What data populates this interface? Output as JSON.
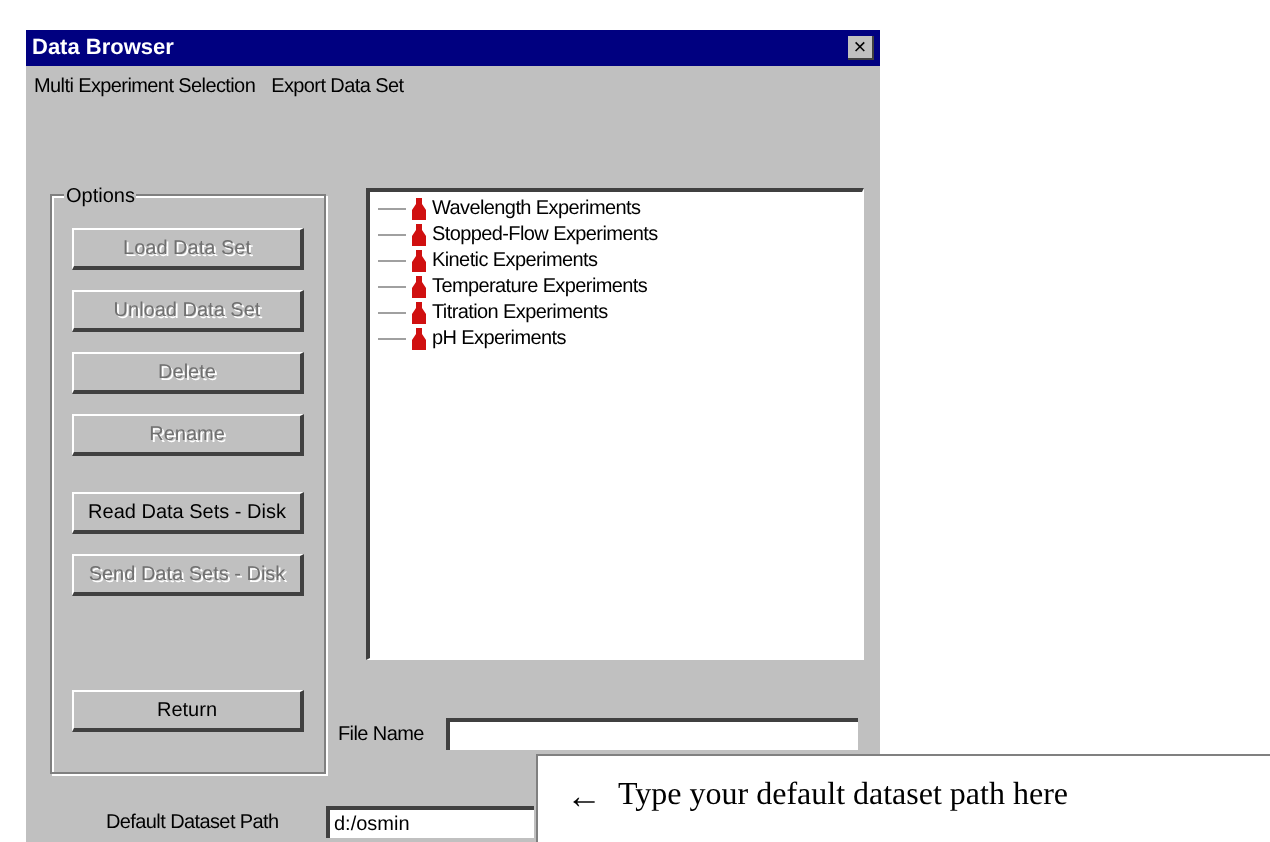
{
  "window": {
    "title": "Data Browser",
    "close": "×"
  },
  "menu": [
    "Multi Experiment Selection",
    "Export Data Set"
  ],
  "options": {
    "label": "Options",
    "buttons": [
      {
        "label": "Load Data Set",
        "disabled": true
      },
      {
        "label": "Unload Data Set",
        "disabled": true
      },
      {
        "label": "Delete",
        "disabled": true
      },
      {
        "label": "Rename",
        "disabled": true
      },
      {
        "label": "Read Data Sets - Disk",
        "disabled": false
      },
      {
        "label": "Send Data Sets - Disk",
        "disabled": true
      }
    ],
    "return_button": {
      "label": "Return",
      "disabled": false
    }
  },
  "tree": {
    "items": [
      "Wavelength Experiments",
      "Stopped-Flow Experiments",
      "Kinetic Experiments",
      "Temperature Experiments",
      "Titration Experiments",
      "pH Experiments"
    ]
  },
  "file_name": {
    "label": "File Name"
  },
  "default_path": {
    "label": "Default Dataset Path",
    "value": "d:/osmin"
  },
  "callout": {
    "arrow": "←",
    "text": "Type your default dataset path here"
  }
}
